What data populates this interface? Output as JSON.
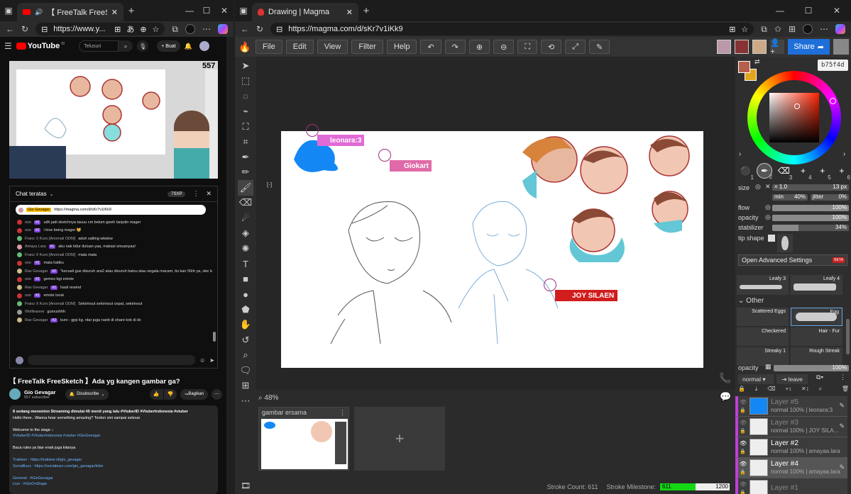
{
  "left_browser": {
    "tab_title": "【 FreeTalk FreeSketch 】Ada y",
    "url": "https://www.y...",
    "youtube": {
      "logo": "YouTube",
      "logo_sup": "ID",
      "search_placeholder": "Telusuri",
      "create_label": "Buat",
      "video_viewer_count": "557",
      "chat_header": "Chat teratas",
      "chat_badge": "7SXP",
      "pinned_user": "Gio Gevagar",
      "pinned_link": "https://magma.com/d/sKr7v1iKk9",
      "chat": [
        {
          "name": "soo",
          "badge": "#2",
          "msg": "udh jadi sketchnya tauuu cm belum gweh lanjutin mager",
          "color": "#c33"
        },
        {
          "name": "soo",
          "badge": "#2",
          "msg": "i love being mager 😸",
          "color": "#c33"
        },
        {
          "name": "Franz X Kuro [Anomali ODM]",
          "badge": "",
          "msg": "aduh salting wkwkw",
          "color": "#6b7"
        },
        {
          "name": "Amaya Lara",
          "badge": "#1",
          "msg": "aku nak tidur duluan yaa, makasi smuanyaa!",
          "color": "#d9a"
        },
        {
          "name": "Franz X Kuro [Anomali ODM]",
          "badge": "",
          "msg": "mata mata",
          "color": "#6b7"
        },
        {
          "name": "soo",
          "badge": "#2",
          "msg": "mata hatiku",
          "color": "#c33"
        },
        {
          "name": "Rav Gevagar",
          "badge": "#2",
          "msg": "\"kecuali gue disuruh ara2 atau disuruh batsu atau segala macam, itu kan 50rb ya, oke lanjut\"",
          "color": "#cb8"
        },
        {
          "name": "soo",
          "badge": "#2",
          "msg": "gemes bgt emote",
          "color": "#c33"
        },
        {
          "name": "Rav Gevagar",
          "badge": "#2",
          "msg": "hasil rewind",
          "color": "#cb8"
        },
        {
          "name": "soo",
          "badge": "#2",
          "msg": "emote luruk",
          "color": "#c33"
        },
        {
          "name": "Franz X Kuro [Anomali ODM]",
          "badge": "",
          "msg": "Sekirinsut sekirinsut cepat, sekirinsut",
          "color": "#6b7"
        },
        {
          "name": "Wolfieanne",
          "badge": "",
          "msg": "gumushhh",
          "color": "#999"
        },
        {
          "name": "Rav Gevagar",
          "badge": "#2",
          "msg": "kuro : gpp kg. ntar juga nanti di share kok di dc",
          "color": "#cb8"
        }
      ],
      "video_title": "【 FreeTalk FreeSketch 】Ada yg kangen gambar ga?",
      "channel": "Gio Gevagar",
      "subscribers": "557 subscriber",
      "subscribe_label": "Disubscribe",
      "share_label": "Bagikan",
      "desc_lines": [
        "8 sedang menonton  Streaming dimulai 45 menit yang lalu  #VtuberID #VtuberIndonesia #vtuber",
        "Hello there.. Wanna hear something amazing? Tonton sini sampai selesai",
        "",
        "Welcome to the stage ↓",
        "#VtuberID #VtuberIndonesia #vtuber  #GioGevagar",
        "",
        "Baca rules ya biar enak juga kitanya",
        "",
        "Trakteer : https://trakteer.id/gio_gevagar",
        "SociaBuzz : https://sociabuzz.com/gio_gevagar/tribe",
        "",
        "General : #GioGevagar",
        "Live : #GioOnStage"
      ]
    }
  },
  "right_browser": {
    "tab_title": "Drawing | Magma",
    "url": "https://magma.com/d/sKr7v1iKk9",
    "menu": [
      "File",
      "Edit",
      "View",
      "Filter",
      "Help"
    ],
    "share_label": "Share",
    "color_hex": "b75f4d",
    "cursors": [
      "leonara:3",
      "Giokart",
      "JOY SILAEN"
    ],
    "zoom": "48%",
    "canvas_card_title": "gambar ersama",
    "tools": {
      "size_label": "size",
      "size_value": "13 px",
      "size_mult": "× 1.0",
      "size_min": "min",
      "size_min_value": "40%",
      "jitter_label": "jitter",
      "jitter_value": "0%",
      "flow_label": "flow",
      "flow_value": "100%",
      "opacity_label": "opacity",
      "opacity_value": "100%",
      "stabilizer_label": "stabilizer",
      "stabilizer_value": "34%",
      "tip_label": "tip shape",
      "advanced": "Open Advanced Settings",
      "beta": "BETA",
      "brush_nums": [
        "1",
        "2",
        "3",
        "4",
        "5",
        "6"
      ]
    },
    "brush_library": {
      "other_label": "Other",
      "brushes": [
        "Leafy 3",
        "Leafy 4",
        "Scattered Eggs",
        "Egg",
        "Checkered",
        "Hair - Fur",
        "Streaky 1",
        "Rough Streak"
      ]
    },
    "layer_opacity_label": "opacity",
    "layer_opacity_value": "100%",
    "blend_mode": "normal",
    "leave_label": "leave",
    "layers": [
      {
        "name": "Layer #5",
        "sub": "normal 100% | leonara:3",
        "active": false
      },
      {
        "name": "Layer #3",
        "sub": "normal 100% | JOY SILA...",
        "active": false
      },
      {
        "name": "Layer #2",
        "sub": "normal 100% | amayaa.lara",
        "active": false
      },
      {
        "name": "Layer #4",
        "sub": "normal 100% | amayaa.lara",
        "active": true
      },
      {
        "name": "Layer #1",
        "sub": "",
        "active": false
      }
    ],
    "status": {
      "stroke_count": "Stroke Count: 611",
      "milestone_label": "Stroke Milestone:",
      "milestone_current": "611",
      "milestone_target": "1200",
      "milestone_progress": 0.51
    }
  }
}
